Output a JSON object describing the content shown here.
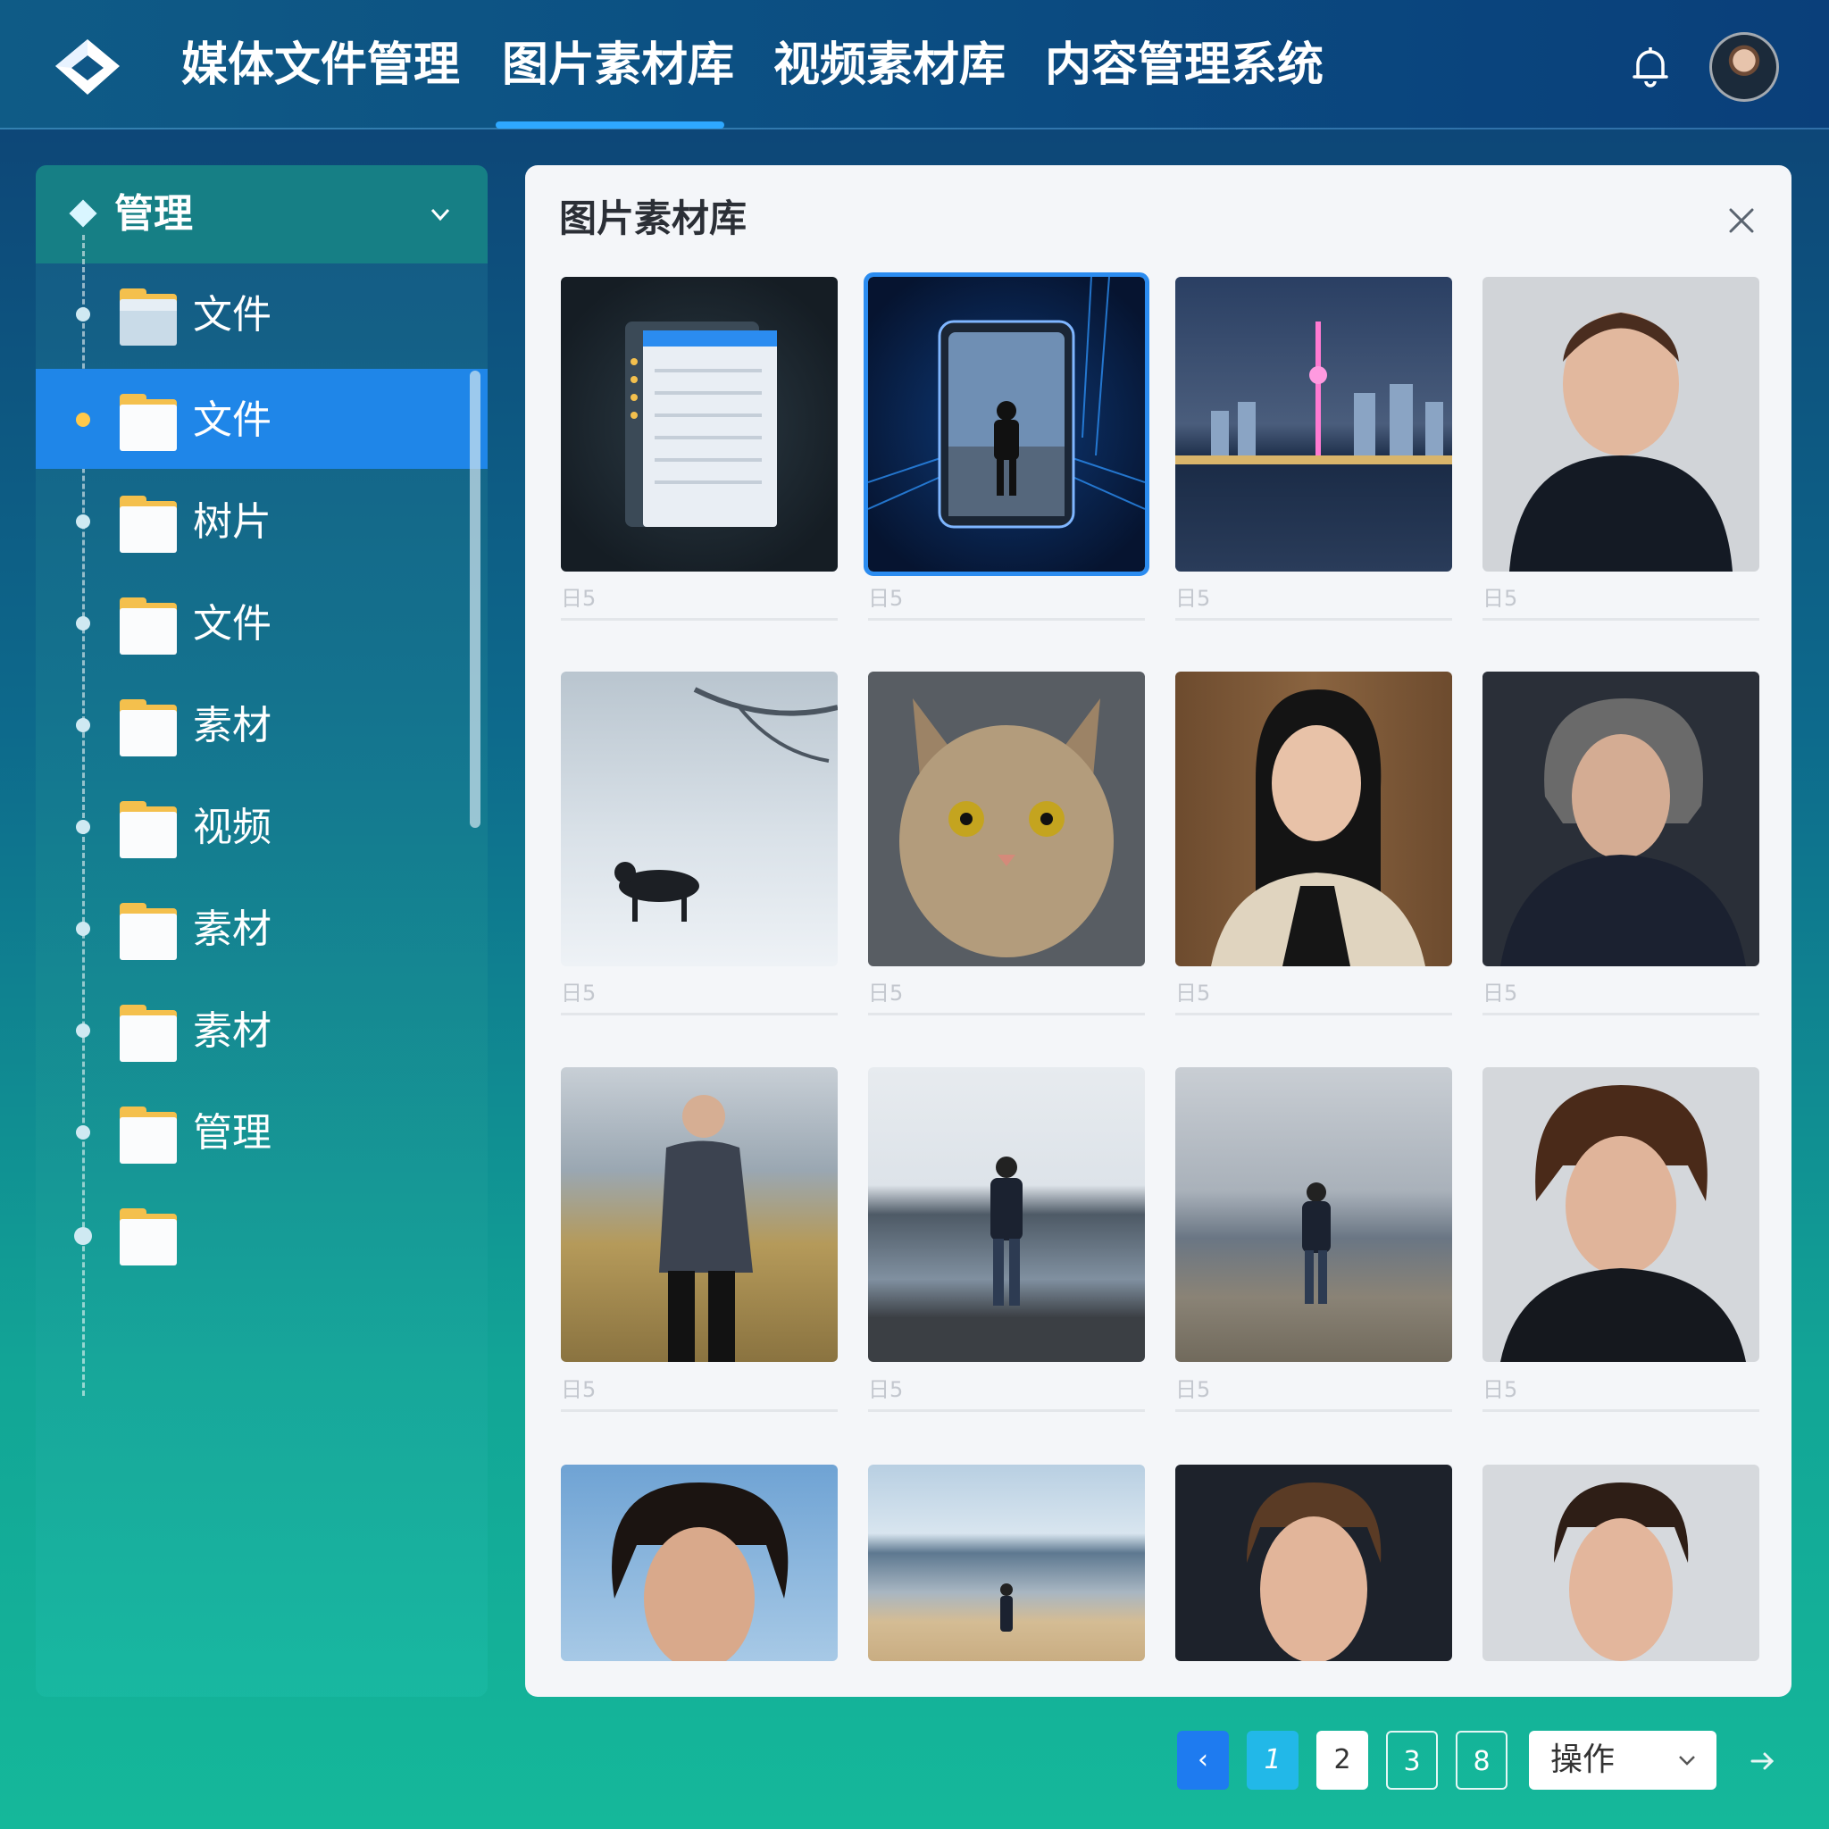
{
  "nav": {
    "items": [
      {
        "label": "媒体文件管理"
      },
      {
        "label": "图片素材库"
      },
      {
        "label": "视频素材库"
      },
      {
        "label": "内容管理系统"
      }
    ],
    "active_index": 1
  },
  "sidebar": {
    "header": "管理",
    "items": [
      {
        "label": "文件"
      },
      {
        "label": "文件"
      },
      {
        "label": "树片"
      },
      {
        "label": "文件"
      },
      {
        "label": "素材"
      },
      {
        "label": "视频"
      },
      {
        "label": "素材"
      },
      {
        "label": "素材"
      },
      {
        "label": "管理"
      },
      {
        "label": ""
      }
    ],
    "active_index": 1
  },
  "panel": {
    "title": "图片素材库",
    "thumbs": [
      {
        "caption": "日5",
        "subject": "document-mockup"
      },
      {
        "caption": "日5",
        "subject": "phone-person-neon",
        "selected": true
      },
      {
        "caption": "日5",
        "subject": "city-night-skyline"
      },
      {
        "caption": "日5",
        "subject": "man-portrait"
      },
      {
        "caption": "日5",
        "subject": "dog-in-snow"
      },
      {
        "caption": "日5",
        "subject": "tabby-cat"
      },
      {
        "caption": "日5",
        "subject": "woman-portrait-library"
      },
      {
        "caption": "日5",
        "subject": "man-curly-hair-dark"
      },
      {
        "caption": "日5",
        "subject": "man-by-lake"
      },
      {
        "caption": "日5",
        "subject": "person-at-sea"
      },
      {
        "caption": "日5",
        "subject": "person-on-rocks"
      },
      {
        "caption": "日5",
        "subject": "man-curly-portrait"
      },
      {
        "caption": "",
        "subject": "young-man-blue-sky"
      },
      {
        "caption": "",
        "subject": "person-on-beach"
      },
      {
        "caption": "",
        "subject": "man-portrait-dark"
      },
      {
        "caption": "",
        "subject": "man-portrait-light"
      }
    ]
  },
  "pagination": {
    "prev_label": "‹",
    "current": "1",
    "pages": [
      "2",
      "3",
      "8"
    ],
    "select_value": "操作",
    "next_label": "›"
  },
  "colors": {
    "accent": "#2b8cf0",
    "active_tree": "#1f86e8",
    "folder": "#f4c04d"
  }
}
